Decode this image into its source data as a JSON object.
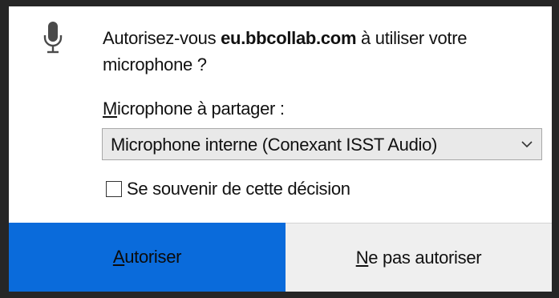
{
  "prompt": {
    "before": "Autorisez-vous ",
    "domain": "eu.bbcollab.com",
    "after": " à utiliser votre microphone ?"
  },
  "share_label": {
    "accel": "M",
    "rest": "icrophone à partager :"
  },
  "device_select": {
    "selected": "Microphone interne (Conexant ISST Audio)"
  },
  "remember": {
    "label": "Se souvenir de cette décision",
    "checked": false
  },
  "buttons": {
    "allow": {
      "accel": "A",
      "rest": "utoriser"
    },
    "deny": {
      "accel": "N",
      "rest": "e pas autoriser"
    }
  },
  "colors": {
    "allow_bg": "#0a6bdb",
    "deny_bg": "#efefef"
  },
  "icons": {
    "microphone": "microphone-icon",
    "dropdown": "chevron-down-icon"
  }
}
